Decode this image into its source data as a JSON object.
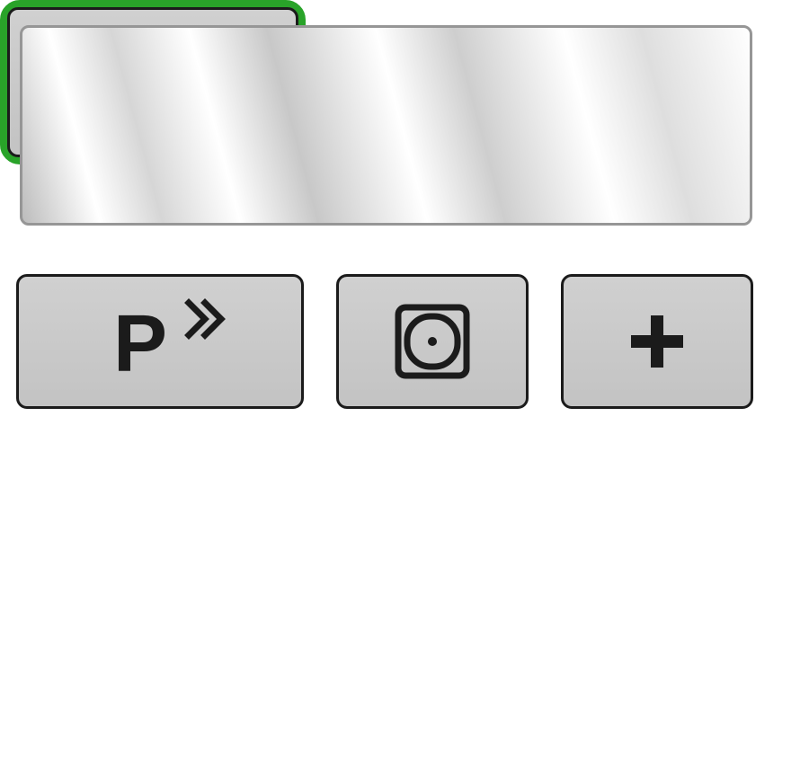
{
  "display": {
    "value": ""
  },
  "buttons": {
    "program": {
      "label": "P",
      "icon": "fast-forward-chevrons"
    },
    "safe": {
      "icon": "rounded-square-dot"
    },
    "plus": {
      "label": "+"
    },
    "power": {
      "icon": "power-circle-line",
      "border_color": "#29a329"
    }
  }
}
